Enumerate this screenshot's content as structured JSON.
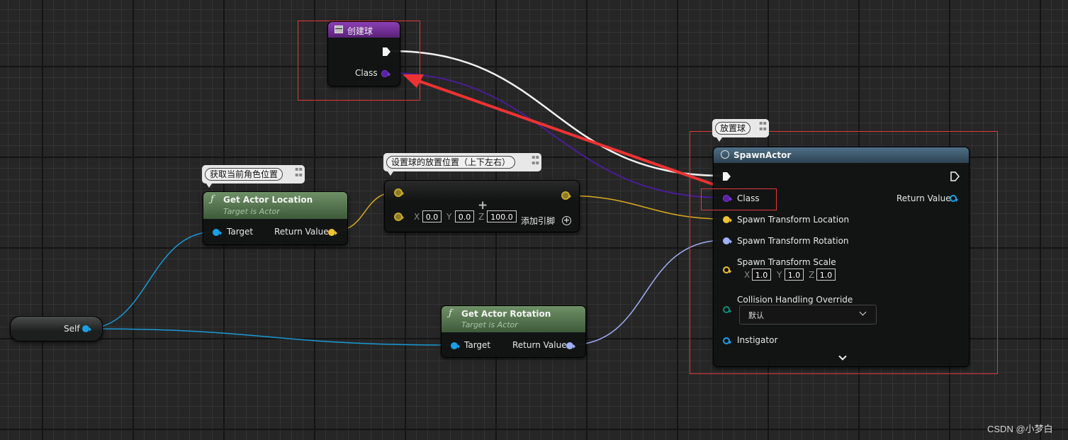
{
  "colors": {
    "class_pin": "#5b1fa8",
    "vector_pin": "#f0c22c",
    "rotator_pin": "#9fb0f7",
    "object_pin": "#1aa0e6",
    "scale_pin": "#f0c22c",
    "collision_pin": "#0d8a78",
    "instigator_pin": "#1aa0e6",
    "highlight_red": "#e03a3a",
    "red_arrow": "#ee3232",
    "function_header": "#5a7b52",
    "spawn_header": "#3e5b6e",
    "custom_event_header": "#6a2f8a"
  },
  "create_ball_node": {
    "icon": "event-grid-icon",
    "title": "创建球",
    "class_label": "Class"
  },
  "get_actor_location": {
    "comment": "获取当前角色位置",
    "title": "Get Actor Location",
    "subtitle": "Target is Actor",
    "target_label": "Target",
    "return_label": "Return Value"
  },
  "make_vector_node": {
    "comment": "设置球的放置位置（上下左右）",
    "x_axis": "X",
    "x_value": "0.0",
    "y_axis": "Y",
    "y_value": "0.0",
    "z_axis": "Z",
    "z_value": "100.0",
    "add_pin_label": "添加引脚"
  },
  "self_node": {
    "label": "Self"
  },
  "get_actor_rotation": {
    "title": "Get Actor Rotation",
    "subtitle": "Target is Actor",
    "target_label": "Target",
    "return_label": "Return Value"
  },
  "spawn_actor_node": {
    "comment": "放置球",
    "title": "SpawnActor",
    "class_label": "Class",
    "return_label": "Return Value",
    "location_label": "Spawn Transform Location",
    "rotation_label": "Spawn Transform Rotation",
    "scale_label": "Spawn Transform Scale",
    "scale_x_axis": "X",
    "scale_x": "1.0",
    "scale_y_axis": "Y",
    "scale_y": "1.0",
    "scale_z_axis": "Z",
    "scale_z": "1.0",
    "collision_label": "Collision Handling Override",
    "collision_value": "默认",
    "instigator_label": "Instigator"
  },
  "watermark": "CSDN @小梦白"
}
